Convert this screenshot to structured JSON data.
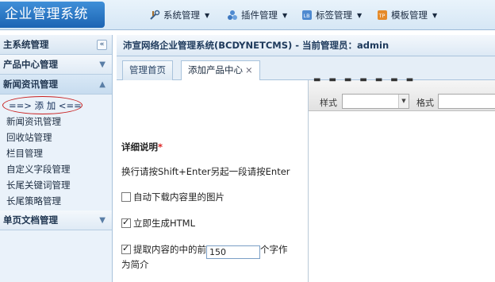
{
  "app": {
    "logo": "企业管理系统"
  },
  "topmenu": [
    {
      "label": "系统管理",
      "icon": "tools-icon"
    },
    {
      "label": "插件管理",
      "icon": "puzzle-icon"
    },
    {
      "label": "标签管理",
      "icon": "label-icon"
    },
    {
      "label": "模板管理",
      "icon": "template-icon"
    }
  ],
  "sidebar": {
    "main_title": "主系统管理",
    "collapse_glyph": "«",
    "sections": [
      {
        "label": "产品中心管理",
        "toggle": "▼"
      },
      {
        "label": "新闻资讯管理",
        "toggle": "▲"
      },
      {
        "label": "单页文档管理",
        "toggle": "▼"
      }
    ],
    "news_items": [
      "==> 添 加 <==",
      "新闻资讯管理",
      "回收站管理",
      "栏目管理",
      "自定义字段管理",
      "长尾关键词管理",
      "长尾策略管理"
    ]
  },
  "header": {
    "title": "沛宣网络企业管理系统(BCDYNETCMS) - 当前管理员：admin"
  },
  "tabs": [
    {
      "label": "管理首页"
    },
    {
      "label": "添加产品中心",
      "close": "×"
    }
  ],
  "form": {
    "detail_label": "详细说明",
    "required_mark": "*",
    "hint": "换行请按Shift+Enter另起一段请按Enter",
    "opt_download": {
      "label": "自动下载内容里的图片",
      "checked": false
    },
    "opt_html": {
      "label": "立即生成HTML",
      "checked": true
    },
    "opt_summary": {
      "prefix": "提取内容的中的前",
      "value": "150",
      "suffix": "个字作",
      "suffix2": "为简介",
      "checked": true
    }
  },
  "editor": {
    "style_label": "样式",
    "format_label": "格式",
    "style_value": "",
    "format_value": ""
  }
}
